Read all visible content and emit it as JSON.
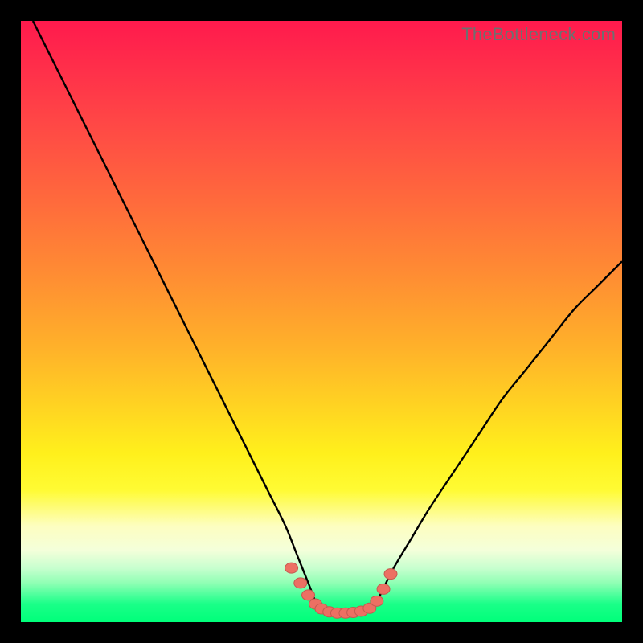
{
  "watermark": "TheBottleneck.com",
  "colors": {
    "frame": "#000000",
    "curve_stroke": "#000000",
    "marker_fill": "#ec7063",
    "marker_stroke": "#c55a50"
  },
  "chart_data": {
    "type": "line",
    "title": "",
    "xlabel": "",
    "ylabel": "",
    "xlim": [
      0,
      100
    ],
    "ylim": [
      0,
      100
    ],
    "grid": false,
    "legend": false,
    "series": [
      {
        "name": "left-curve",
        "x": [
          2,
          6,
          10,
          14,
          18,
          22,
          26,
          30,
          34,
          38,
          41,
          44,
          46,
          48,
          49.5
        ],
        "values": [
          100,
          92,
          84,
          76,
          68,
          60,
          52,
          44,
          36,
          28,
          22,
          16,
          11,
          6,
          2
        ]
      },
      {
        "name": "right-curve",
        "x": [
          58.5,
          60,
          62,
          65,
          68,
          72,
          76,
          80,
          84,
          88,
          92,
          96,
          100
        ],
        "values": [
          2,
          5,
          9,
          14,
          19,
          25,
          31,
          37,
          42,
          47,
          52,
          56,
          60
        ]
      },
      {
        "name": "flat-bottom",
        "x": [
          49.5,
          51,
          53,
          55,
          57,
          58.5
        ],
        "values": [
          2,
          1.5,
          1.3,
          1.3,
          1.5,
          2
        ]
      }
    ],
    "markers": [
      {
        "x": 45.0,
        "y": 9.0
      },
      {
        "x": 46.5,
        "y": 6.5
      },
      {
        "x": 47.8,
        "y": 4.5
      },
      {
        "x": 49.0,
        "y": 3.0
      },
      {
        "x": 50.0,
        "y": 2.2
      },
      {
        "x": 51.3,
        "y": 1.7
      },
      {
        "x": 52.6,
        "y": 1.5
      },
      {
        "x": 54.0,
        "y": 1.5
      },
      {
        "x": 55.3,
        "y": 1.6
      },
      {
        "x": 56.6,
        "y": 1.8
      },
      {
        "x": 58.0,
        "y": 2.3
      },
      {
        "x": 59.2,
        "y": 3.5
      },
      {
        "x": 60.3,
        "y": 5.5
      },
      {
        "x": 61.5,
        "y": 8.0
      }
    ]
  }
}
